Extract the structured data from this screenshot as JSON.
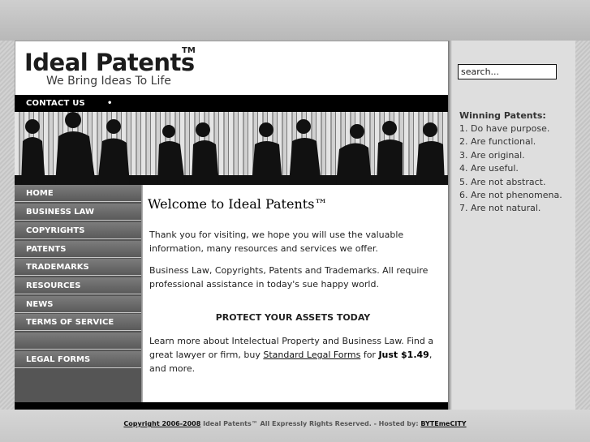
{
  "header": {
    "logo_title": "Ideal Patents",
    "logo_tm": "TM",
    "tagline": "We Bring Ideas To Life"
  },
  "topnav": {
    "contact": "CONTACT US",
    "separator": "•"
  },
  "sidebar": {
    "items": [
      {
        "label": "HOME"
      },
      {
        "label": "BUSINESS LAW"
      },
      {
        "label": "COPYRIGHTS"
      },
      {
        "label": "PATENTS"
      },
      {
        "label": "TRADEMARKS"
      },
      {
        "label": "RESOURCES"
      },
      {
        "label": "NEWS"
      },
      {
        "label": "TERMS OF SERVICE"
      },
      {
        "label": ""
      },
      {
        "label": "LEGAL FORMS"
      }
    ]
  },
  "main": {
    "title": "Welcome to Ideal Patents™",
    "para1": "Thank you for visiting, we hope you will use the valuable information, many resources and services we offer.",
    "para2": "Business Law, Copyrights, Patents and Trademarks. All require professional assistance in today's sue happy world.",
    "protect": "PROTECT YOUR ASSETS TODAY",
    "para3_start": "Learn more about Intelectual Property and Business Law. Find a great lawyer or firm, buy ",
    "para3_link": "Standard Legal Forms",
    "para3_mid": " for ",
    "para3_price": "Just $1.49",
    "para3_end": ", and more."
  },
  "right": {
    "search_value": "search...",
    "winning_title": "Winning Patents:",
    "winning_items": [
      "1. Do have purpose.",
      "2. Are functional.",
      "3. Are original.",
      "4. Are useful.",
      "5. Are not abstract.",
      "6. Are not phenomena.",
      "7. Are not natural."
    ]
  },
  "footer": {
    "copyright_link": "Copyright 2006-2008",
    "copyright_text": " Ideal Patents™ All Expressly Rights Reserved. - Hosted by: ",
    "host_link": "BYTEmeCITY"
  },
  "colors": {
    "nav_bar": "#000000",
    "sidebar_button": "#6a6a6a",
    "right_panel": "#dedede"
  }
}
